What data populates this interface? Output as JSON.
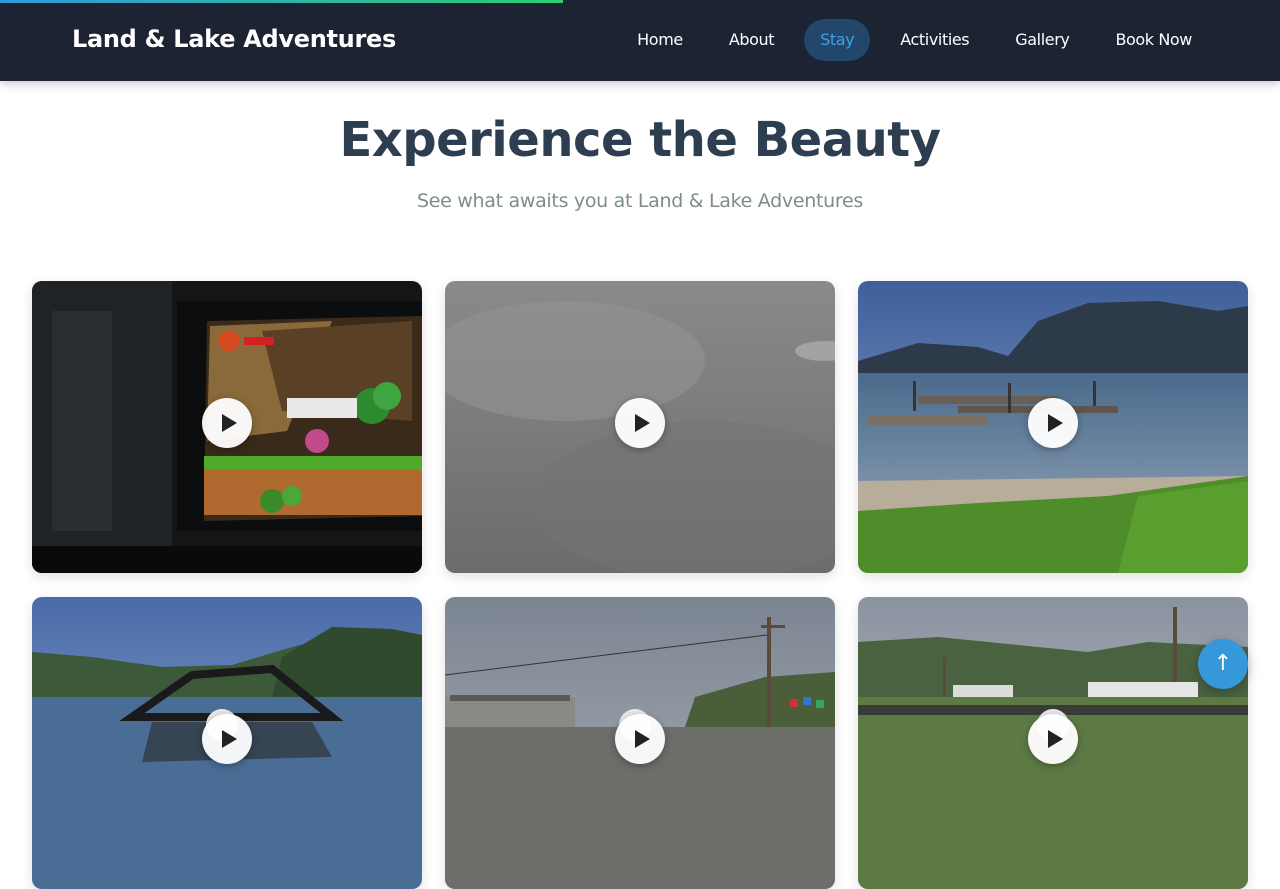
{
  "header": {
    "logo": "Land & Lake Adventures",
    "nav": [
      "Home",
      "About",
      "Stay",
      "Activities",
      "Gallery",
      "Book Now"
    ],
    "active_nav": "Stay"
  },
  "scroll_progress_percent": 44,
  "hero": {
    "title": "Experience the Beauty",
    "subtitle": "See what awaits you at Land & Lake Adventures"
  },
  "gallery": {
    "videos": [
      {
        "scene": "TV screen showing a platform video game",
        "has_play_button": true
      },
      {
        "scene": "grey gravel ground",
        "has_play_button": true
      },
      {
        "scene": "lake with docks and mountains",
        "has_play_button": true
      },
      {
        "scene": "boat on a lake",
        "has_play_button": true
      },
      {
        "scene": "road with power pole and flags",
        "has_play_button": true
      },
      {
        "scene": "lakeside road with mountains",
        "has_play_button": true
      }
    ]
  },
  "scroll_top_icon": "arrow-up-icon",
  "scroll_top_glyph": "↑",
  "colors": {
    "header_bg": "#1c2333",
    "active_nav_text": "#3ea0e6",
    "active_nav_bg": "#22476b",
    "title": "#2c3e50",
    "subtitle": "#7f8c8d",
    "accent": "#3498db"
  }
}
